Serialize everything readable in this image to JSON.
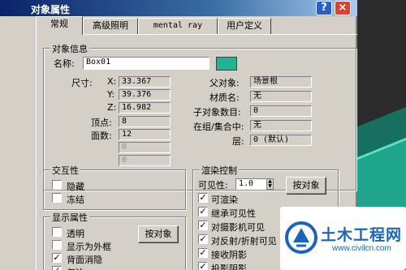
{
  "window": {
    "title": "对象属性"
  },
  "title_buttons": {
    "help": "?",
    "close": "×"
  },
  "tabs": [
    {
      "label": "常规",
      "active": true
    },
    {
      "label": "高级照明",
      "active": false
    },
    {
      "label": "mental ray",
      "active": false
    },
    {
      "label": "用户定义",
      "active": false
    }
  ],
  "object_info": {
    "legend": "对象信息",
    "name_label": "名称:",
    "name_value": "Box01",
    "color": "#20b493",
    "dimensions_label": "尺寸:",
    "x_label": "X:",
    "x_value": "33.367",
    "y_label": "Y:",
    "y_value": "39.376",
    "z_label": "Z:",
    "z_value": "16.982",
    "vertices_label": "顶点:",
    "vertices_value": "8",
    "faces_label": "面数:",
    "faces_value": "12",
    "extra1_value": "0",
    "extra2_value": "0",
    "parent_label": "父对象:",
    "parent_value": "场景根",
    "material_label": "材质名:",
    "material_value": "无",
    "children_label": "子对象数目:",
    "children_value": "0",
    "group_label": "在组/集合中:",
    "group_value": "无",
    "layer_label": "层:",
    "layer_value": "0 (默认)"
  },
  "interactivity": {
    "legend": "交互性",
    "hide_label": "隐藏",
    "hide_checked": false,
    "freeze_label": "冻结",
    "freeze_checked": false
  },
  "display_props": {
    "legend": "显示属性",
    "transparent_label": "透明",
    "transparent_checked": false,
    "as_box_label": "显示为外框",
    "as_box_checked": false,
    "backface_label": "背面消隐",
    "backface_checked": true,
    "edges_label": "仅边",
    "edges_checked": true,
    "by_object_button": "按对象"
  },
  "render_control": {
    "legend": "渲染控制",
    "visibility_label": "可见性:",
    "visibility_value": "1.0",
    "by_object_button": "按对象",
    "renderable_label": "可渲染",
    "renderable_checked": true,
    "inherit_visibility_label": "继承可见性",
    "inherit_visibility_checked": true,
    "visible_to_camera_label": "对摄影机可见",
    "visible_to_camera_checked": true,
    "visible_to_reflection_label": "对反射/折射可见",
    "visible_to_reflection_checked": true,
    "receive_shadows_label": "接收阴影",
    "receive_shadows_checked": true,
    "cast_shadows_label": "投影阴影",
    "cast_shadows_checked": true
  },
  "watermark": {
    "title": "土木工程网",
    "url": "www.civilcn.com"
  }
}
